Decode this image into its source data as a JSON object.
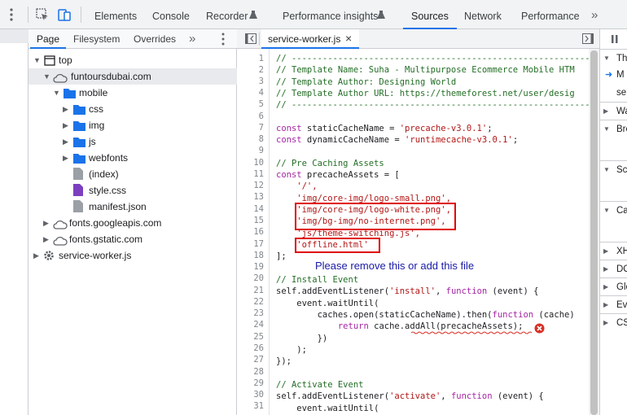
{
  "toolbar": {
    "tabs": [
      {
        "label": "Elements"
      },
      {
        "label": "Console"
      },
      {
        "label": "Recorder"
      },
      {
        "label": "Performance insights"
      },
      {
        "label": "Sources"
      },
      {
        "label": "Network"
      },
      {
        "label": "Performance"
      }
    ],
    "more": "»"
  },
  "navigator": {
    "tabs": [
      "Page",
      "Filesystem",
      "Overrides"
    ],
    "more": "»",
    "tree": [
      {
        "label": "top"
      },
      {
        "label": "funtoursdubai.com"
      },
      {
        "label": "mobile"
      },
      {
        "label": "css"
      },
      {
        "label": "img"
      },
      {
        "label": "js"
      },
      {
        "label": "webfonts"
      },
      {
        "label": "(index)"
      },
      {
        "label": "style.css"
      },
      {
        "label": "manifest.json"
      },
      {
        "label": "fonts.googleapis.com"
      },
      {
        "label": "fonts.gstatic.com"
      },
      {
        "label": "service-worker.js"
      }
    ]
  },
  "editor": {
    "tab": "service-worker.js",
    "close": "×",
    "annotation": "Please remove this or add this file",
    "colors": {
      "highlight_box": "#e00000",
      "annotation": "#1a1aa6",
      "error": "#d93025"
    }
  },
  "right_panel": {
    "items": [
      "Th",
      "M",
      "se",
      "Wa",
      "Bre",
      "Sco",
      "Ca",
      "XH",
      "DO",
      "Glo",
      "Eve",
      "CS"
    ]
  }
}
